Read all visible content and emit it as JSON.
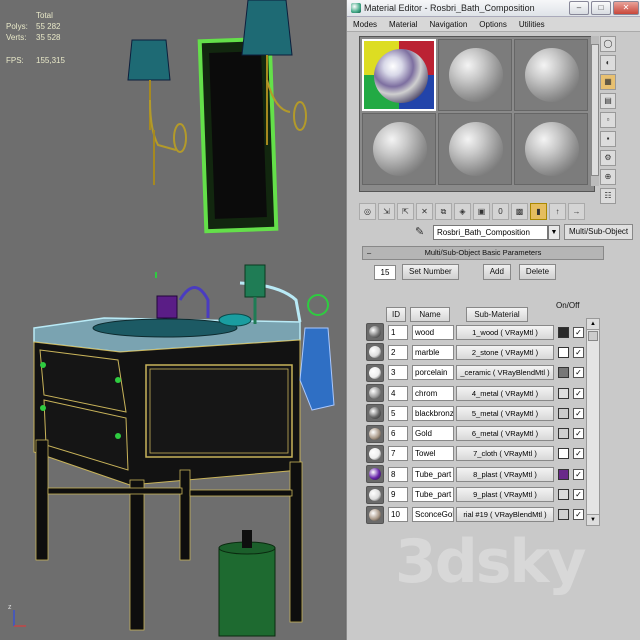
{
  "viewport": {
    "stats": {
      "total_label": "Total",
      "rows": [
        {
          "label": "Polys:",
          "value": "55 282"
        },
        {
          "label": "Verts:",
          "value": "35 528"
        },
        {
          "label": "FPS:",
          "value": "155,315"
        }
      ]
    },
    "axis_label": "z"
  },
  "window": {
    "title": "Material Editor - Rosbri_Bath_Composition",
    "controls": {
      "minimize": "–",
      "maximize": "□",
      "close": "✕"
    }
  },
  "menu": [
    "Modes",
    "Material",
    "Navigation",
    "Options",
    "Utilities"
  ],
  "material": {
    "name": "Rosbri_Bath_Composition",
    "type": "Multi/Sub-Object"
  },
  "rollout": {
    "title": "Multi/Sub-Object Basic Parameters",
    "count": "15",
    "set_number": "Set Number",
    "add": "Add",
    "delete": "Delete"
  },
  "table": {
    "headers": {
      "id": "ID",
      "name": "Name",
      "sub": "Sub-Material",
      "onoff": "On/Off"
    },
    "rows": [
      {
        "id": "1",
        "name": "wood",
        "sub": "1_wood  ( VRayMtl )",
        "color": "#2a2a2a",
        "ball": "#777",
        "on": "✓"
      },
      {
        "id": "2",
        "name": "marble",
        "sub": "2_stone  ( VRayMtl )",
        "color": "#ffffff",
        "ball": "#ddd",
        "on": "✓"
      },
      {
        "id": "3",
        "name": "porcelain",
        "sub": "_ceramic  ( VRayBlendMtl )",
        "color": "#777777",
        "ball": "#eee",
        "on": "✓"
      },
      {
        "id": "4",
        "name": "chrom",
        "sub": "4_metal  ( VRayMtl )",
        "color": "#dddddd",
        "ball": "#999",
        "on": "✓"
      },
      {
        "id": "5",
        "name": "blackbronz",
        "sub": "5_metal  ( VRayMtl )",
        "color": "#cccccc",
        "ball": "#666",
        "on": "✓"
      },
      {
        "id": "6",
        "name": "Gold",
        "sub": "6_metal  ( VRayMtl )",
        "color": "#cfcfcf",
        "ball": "#a98",
        "on": "✓"
      },
      {
        "id": "7",
        "name": "Towel",
        "sub": "7_cloth  ( VRayMtl )",
        "color": "#ffffff",
        "ball": "#eee",
        "on": "✓"
      },
      {
        "id": "8",
        "name": "Tube_part",
        "sub": "8_plast  ( VRayMtl )",
        "color": "#6a2a8a",
        "ball": "#62a",
        "on": "✓"
      },
      {
        "id": "9",
        "name": "Tube_part",
        "sub": "9_plast  ( VRayMtl )",
        "color": "#dddddd",
        "ball": "#ddd",
        "on": "✓"
      },
      {
        "id": "10",
        "name": "SconceGold",
        "sub": "rial #19  ( VRayBlendMtl )",
        "color": "#cfcfcf",
        "ball": "#a98",
        "on": "✓"
      }
    ]
  },
  "watermark": "3dsky"
}
